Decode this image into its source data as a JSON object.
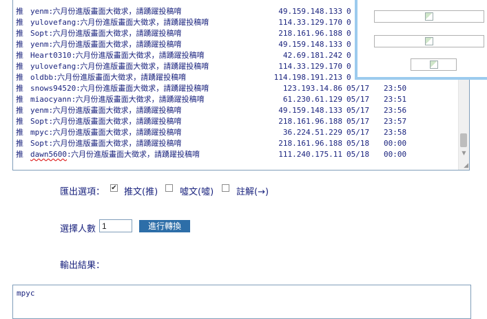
{
  "comments": [
    {
      "tag": "推",
      "user": "yenm",
      "msg": "六月份進版畫面大徵求，請踴躍投稿唷",
      "ip": "49.159.148.133",
      "date": "0",
      "time": ""
    },
    {
      "tag": "推",
      "user": "yulovefang",
      "msg": "六月份進版畫面大徵求，請踴躍投稿唷",
      "ip": "114.33.129.170",
      "date": "0",
      "time": ""
    },
    {
      "tag": "推",
      "user": "Sopt",
      "msg": "六月份進版畫面大徵求，請踴躍投稿唷",
      "ip": "218.161.96.188",
      "date": "0",
      "time": ""
    },
    {
      "tag": "推",
      "user": "yenm",
      "msg": "六月份進版畫面大徵求，請踴躍投稿唷",
      "ip": "49.159.148.133",
      "date": "0",
      "time": ""
    },
    {
      "tag": "推",
      "user": "Heart0310",
      "msg": "六月份進版畫面大徵求，請踴躍投稿唷",
      "ip": "42.69.181.242",
      "date": "0",
      "time": ""
    },
    {
      "tag": "推",
      "user": "yulovefang",
      "msg": "六月份進版畫面大徵求，請踴躍投稿唷",
      "ip": "114.33.129.170",
      "date": "0",
      "time": ""
    },
    {
      "tag": "推",
      "user": "oldbb",
      "msg": "六月份進版畫面大徵求，請踴躍投稿唷",
      "ip": "114.198.191.213",
      "date": "0",
      "time": ""
    },
    {
      "tag": "推",
      "user": "snows94520",
      "msg": "六月份進版畫面大徵求，請踴躍投稿唷",
      "ip": "123.193.14.86",
      "date": "05/17",
      "time": "23:50"
    },
    {
      "tag": "推",
      "user": "miaocyann",
      "msg": "六月份進版畫面大徵求，請踴躍投稿唷",
      "ip": "61.230.61.129",
      "date": "05/17",
      "time": "23:51"
    },
    {
      "tag": "推",
      "user": "yenm",
      "msg": "六月份進版畫面大徵求，請踴躍投稿唷",
      "ip": "49.159.148.133",
      "date": "05/17",
      "time": "23:56"
    },
    {
      "tag": "推",
      "user": "Sopt",
      "msg": "六月份進版畫面大徵求，請踴躍投稿唷",
      "ip": "218.161.96.188",
      "date": "05/17",
      "time": "23:57"
    },
    {
      "tag": "推",
      "user": "mpyc",
      "msg": "六月份進版畫面大徵求，請踴躍投稿唷",
      "ip": "36.224.51.229",
      "date": "05/17",
      "time": "23:58"
    },
    {
      "tag": "推",
      "user": "Sopt",
      "msg": "六月份進版畫面大徵求，請踴躍投稿唷",
      "ip": "218.161.96.188",
      "date": "05/18",
      "time": "00:00"
    },
    {
      "tag": "推",
      "user": "dawn5600",
      "msg": "六月份進版畫面大徵求，請踴躍投稿唷",
      "ip": "111.240.175.11",
      "date": "05/18",
      "time": "00:00"
    }
  ],
  "export_options": {
    "label": "匯出選項：",
    "push_label": "推文(推)",
    "push_checked": true,
    "boo_label": "噓文(噓)",
    "boo_checked": false,
    "note_label": "註解(→)",
    "note_checked": false
  },
  "select": {
    "label": "選擇人數",
    "count": "1",
    "button_label": "進行轉換"
  },
  "output": {
    "label": "輸出結果：",
    "result": "mpyc"
  },
  "icons": {
    "broken_image": "broken-image-icon",
    "check": "✔",
    "scroll_down": "▼",
    "resize_grip": "◢"
  },
  "colors": {
    "text": "#1a237e",
    "button": "#2d6ea8",
    "overlay_border": "#9ccbee"
  }
}
